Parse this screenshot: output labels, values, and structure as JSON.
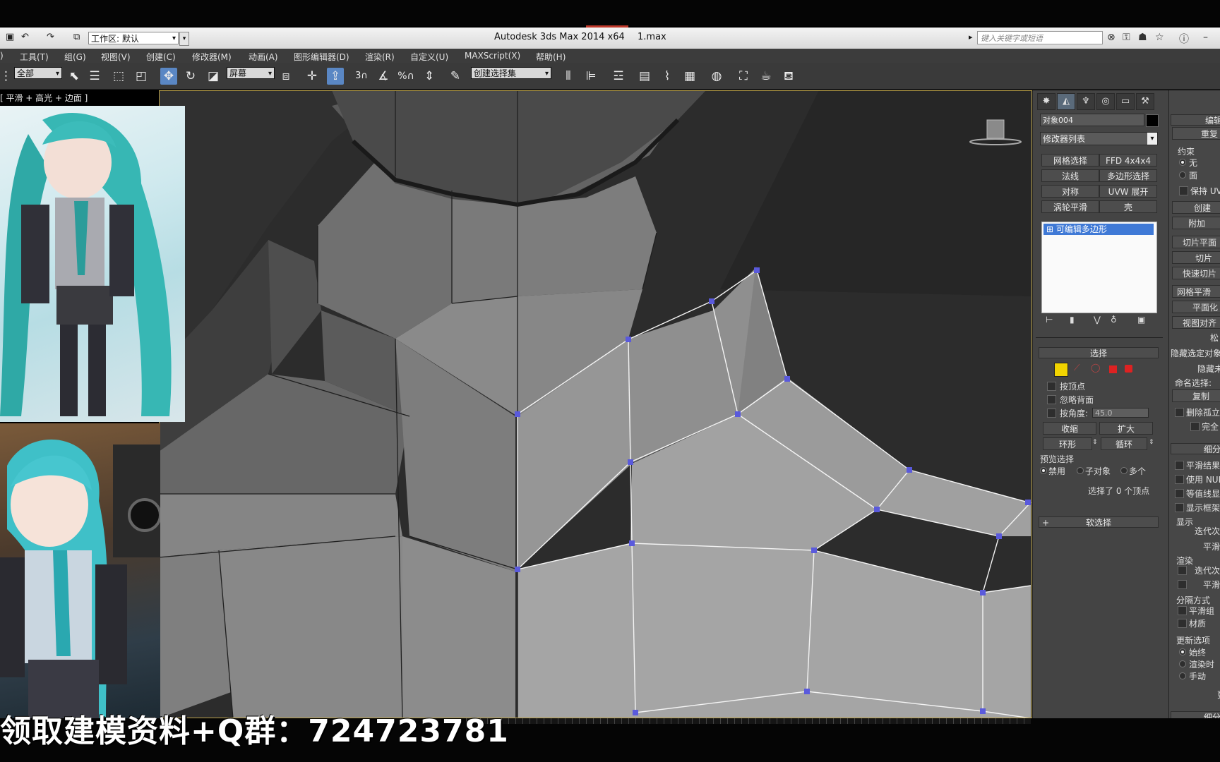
{
  "title_bar": {
    "workspace_label": "工作区: 默认",
    "app_title": "Autodesk 3ds Max  2014 x64",
    "file_name": "1.max",
    "search_placeholder": "键入关键字或短语"
  },
  "menu": [
    "工具(T)",
    "组(G)",
    "视图(V)",
    "创建(C)",
    "修改器(M)",
    "动画(A)",
    "图形编辑器(D)",
    "渲染(R)",
    "自定义(U)",
    "MAXScript(X)",
    "帮助(H)"
  ],
  "toolbar": {
    "selection_filter": "全部",
    "reference_coord": "屏幕",
    "named_selection": "创建选择集"
  },
  "viewport": {
    "label": "[ 平滑 + 高光 + 边面 ]",
    "background": "#2d2d2d",
    "vertex_color": "#5a5adc"
  },
  "command_panel": {
    "object_name": "对象004",
    "modifier_list": "修改器列表",
    "modifier_buttons": [
      "网格选择",
      "FFD 4x4x4",
      "法线",
      "多边形选择",
      "对称",
      "UVW 展开",
      "涡轮平滑",
      "壳"
    ],
    "stack_item": "可编辑多边形",
    "selection_rollout": {
      "title": "选择",
      "by_vertex": "按顶点",
      "ignore_backface": "忽略背面",
      "by_angle": "按角度:",
      "angle_value": "45.0",
      "shrink": "收缩",
      "grow": "扩大",
      "ring": "环形",
      "loop": "循环",
      "preview_label": "预览选择",
      "preview_off": "禁用",
      "preview_subobj": "子对象",
      "preview_multi": "多个",
      "status": "选择了 0 个顶点"
    },
    "soft_selection": "软选择"
  },
  "command_panel_right": {
    "edit_geometry": "编辑",
    "repeat": "重复",
    "constraints": "约束",
    "none": "无",
    "face": "面",
    "preserve_uv": "保持 UV",
    "create": "创建",
    "attach": "附加",
    "slice_plane": "切片平面",
    "slice": "切片",
    "quick_slice": "快速切片",
    "meshsmooth": "网格平滑",
    "planarize": "平面化",
    "view_align": "视图对齐",
    "relax": "松",
    "hide_selected": "隐藏选定对象",
    "hide_unselected": "隐藏未",
    "named_selection": "命名选择:",
    "copy": "复制",
    "delete_isolated": "删除孤立",
    "full": "完全",
    "subdivision": "细分",
    "smooth_result": "平滑结果",
    "use_nurms": "使用 NUR",
    "isoline": "等值线显",
    "show_cage": "显示框架",
    "display": "显示",
    "iterations": "迭代次",
    "smoothness": "平滑",
    "render": "渲染",
    "iterations2": "迭代次",
    "smoothness2": "平滑",
    "separate_by": "分隔方式",
    "smoothing_groups": "平滑组",
    "materials": "材质",
    "update_options": "更新选项",
    "always": "始终",
    "when_rendering": "渲染时",
    "manually": "手动",
    "update": "更",
    "subdivision2": "细分"
  },
  "caption": "领取建模资料+Q群：724723781"
}
